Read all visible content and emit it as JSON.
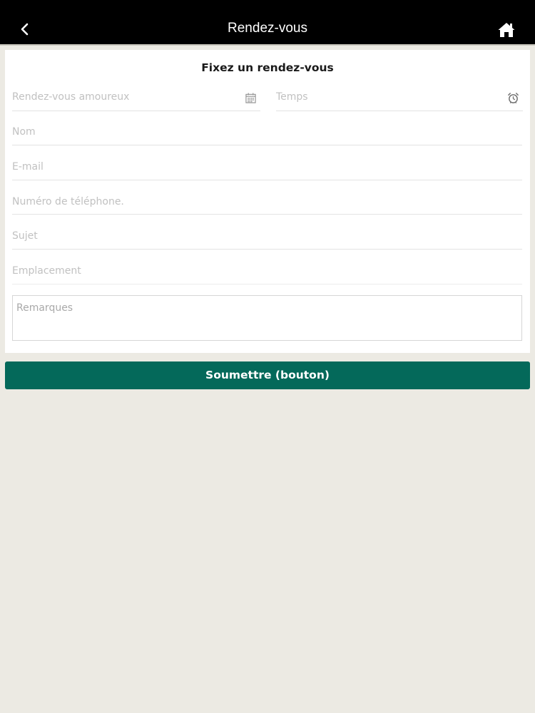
{
  "header": {
    "title": "Rendez-vous",
    "back_icon": "chevron-left-icon",
    "home_icon": "home-icon"
  },
  "form": {
    "title": "Fixez un rendez-vous",
    "date_placeholder": "Rendez-vous amoureux",
    "time_placeholder": "Temps",
    "name_placeholder": "Nom",
    "email_placeholder": "E-mail",
    "phone_placeholder": "Numéro de téléphone.",
    "subject_placeholder": "Sujet",
    "location_placeholder": "Emplacement",
    "remarks_placeholder": "Remarques",
    "calendar_icon": "calendar-icon",
    "clock_icon": "alarm-clock-icon"
  },
  "submit": {
    "label": "Soumettre (bouton)"
  },
  "colors": {
    "header_bg": "#000000",
    "page_bg": "#eceae3",
    "accent": "#04695a"
  }
}
